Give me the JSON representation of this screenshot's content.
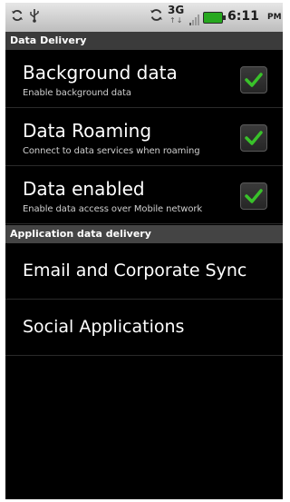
{
  "status_bar": {
    "time": "6:11",
    "ampm": "PM",
    "network": "3G",
    "icons": [
      "sync-icon",
      "usb-icon",
      "sync-icon",
      "signal-icon",
      "battery-icon"
    ]
  },
  "sections": {
    "data_delivery": "Data Delivery",
    "application_data_delivery": "Application data delivery"
  },
  "checkbox_settings": [
    {
      "title": "Background data",
      "summary": "Enable background data",
      "checked": true
    },
    {
      "title": "Data Roaming",
      "summary": "Connect to data services when roaming",
      "checked": true
    },
    {
      "title": "Data enabled",
      "summary": "Enable data access over Mobile network",
      "checked": true
    }
  ],
  "app_items": [
    {
      "title": "Email and Corporate Sync"
    },
    {
      "title": "Social Applications"
    }
  ],
  "colors": {
    "check_green": "#39c22a",
    "background": "#000000",
    "header": "#3b3b3b"
  }
}
